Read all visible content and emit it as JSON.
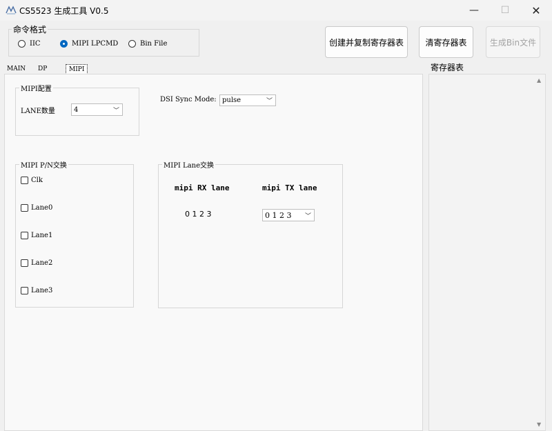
{
  "window": {
    "title": "CS5523 生成工具 V0.5",
    "app_icon": "app-logo-icon",
    "controls": {
      "minimize": "—",
      "maximize": "☐",
      "close": "✕"
    }
  },
  "command_format": {
    "legend": "命令格式",
    "options": [
      {
        "label": "IIC",
        "selected": false
      },
      {
        "label": "MIPI LPCMD",
        "selected": true
      },
      {
        "label": "Bin File",
        "selected": false
      }
    ]
  },
  "toolbar": {
    "create_copy_label": "创建并复制寄存器表",
    "clear_label": "清寄存器表",
    "generate_bin_label": "生成Bin文件"
  },
  "tabs": [
    {
      "label": "MAIN",
      "active": false
    },
    {
      "label": "DP",
      "active": false
    },
    {
      "label": "MIPI",
      "active": true
    }
  ],
  "register_panel": {
    "title": "寄存器表"
  },
  "mipi_config": {
    "legend": "MIPI配置",
    "lane_count_label": "LANE数量",
    "lane_count_value": "4",
    "dsi_sync_label": "DSI Sync Mode:",
    "dsi_sync_value": "pulse"
  },
  "pn_swap": {
    "legend": "MIPI P/N交换",
    "items": [
      "Clk",
      "Lane0",
      "Lane1",
      "Lane2",
      "Lane3"
    ]
  },
  "lane_swap": {
    "legend": "MIPI Lane交换",
    "rx_header": "mipi RX lane",
    "tx_header": "mipi TX lane",
    "rx_value": "0 1 2 3",
    "tx_value": "0 1 2 3"
  },
  "colors": {
    "accent": "#0067c0",
    "background": "#f0f0f0",
    "panel": "#f9f9f9"
  }
}
